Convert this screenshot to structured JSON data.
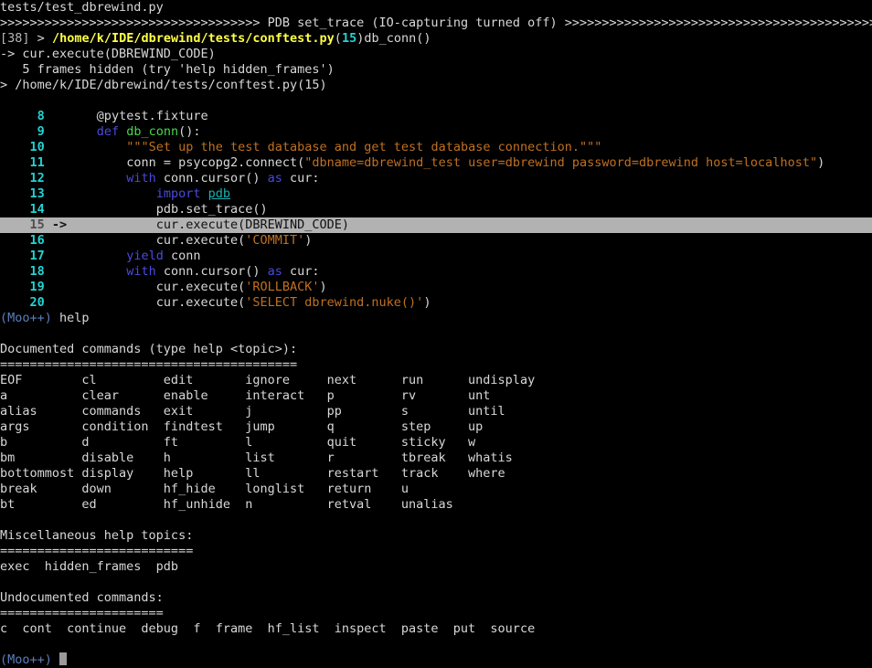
{
  "terminal": {
    "title": "tests/test_dbrewind.py",
    "background": "#000000",
    "foreground": "#d8d8d8",
    "highlight_color": "#b2b2b2",
    "prompt": "(Moo++)"
  },
  "header": {
    "file_line": "tests/test_dbrewind.py",
    "separator_left": ">>>>>>>>>>>>>>>>>>>>>>>>>>>>>>>>>>>",
    "separator_label": "PDB set_trace (IO-capturing turned off)",
    "separator_right": ">>>>>>>>>>>>>>>>>>>>>>>>>>>>>>>>>>>>>>>>>>>>>>>>>>>>>",
    "frame_index": "[38]",
    "frame_gt": ">",
    "frame_path": "/home/k/IDE/dbrewind/tests/conftest.py",
    "frame_open_paren": "(",
    "frame_lineno": "15",
    "frame_close_paren": ")",
    "frame_func": "db_conn()",
    "current_stmt": "-> cur.execute(DBREWIND_CODE)",
    "frames_hidden": "   5 frames hidden (try 'help hidden_frames')",
    "location_line": "> /home/k/IDE/dbrewind/tests/conftest.py(15)"
  },
  "source": {
    "lines": [
      {
        "number": "8",
        "arrow": "",
        "current": false,
        "tokens": [
          {
            "text": "    @pytest.fixture",
            "cls": "c-white"
          }
        ]
      },
      {
        "number": "9",
        "arrow": "",
        "current": false,
        "tokens": [
          {
            "text": "    ",
            "cls": "c-white"
          },
          {
            "text": "def",
            "cls": "c-blue"
          },
          {
            "text": " ",
            "cls": "c-white"
          },
          {
            "text": "db_conn",
            "cls": "c-green"
          },
          {
            "text": "():",
            "cls": "c-white"
          }
        ]
      },
      {
        "number": "10",
        "arrow": "",
        "current": false,
        "tokens": [
          {
            "text": "        ",
            "cls": "c-white"
          },
          {
            "text": "\"\"\"Set up the test database and get test database connection.\"\"\"",
            "cls": "c-orange"
          }
        ]
      },
      {
        "number": "11",
        "arrow": "",
        "current": false,
        "tokens": [
          {
            "text": "        conn = psycopg2.connect(",
            "cls": "c-white"
          },
          {
            "text": "\"dbname=dbrewind_test user=dbrewind password=dbrewind host=localhost\"",
            "cls": "c-orange"
          },
          {
            "text": ")",
            "cls": "c-white"
          }
        ]
      },
      {
        "number": "12",
        "arrow": "",
        "current": false,
        "tokens": [
          {
            "text": "        ",
            "cls": "c-white"
          },
          {
            "text": "with",
            "cls": "c-blue"
          },
          {
            "text": " conn.cursor() ",
            "cls": "c-white"
          },
          {
            "text": "as",
            "cls": "c-blue"
          },
          {
            "text": " cur:",
            "cls": "c-white"
          }
        ]
      },
      {
        "number": "13",
        "arrow": "",
        "current": false,
        "tokens": [
          {
            "text": "            ",
            "cls": "c-white"
          },
          {
            "text": "import",
            "cls": "c-blue"
          },
          {
            "text": " ",
            "cls": "c-white"
          },
          {
            "text": "pdb",
            "cls": "c-cyan underline"
          }
        ]
      },
      {
        "number": "14",
        "arrow": "",
        "current": false,
        "tokens": [
          {
            "text": "            pdb.set_trace()",
            "cls": "c-white"
          }
        ]
      },
      {
        "number": "15",
        "arrow": "->",
        "current": true,
        "tokens": [
          {
            "text": "            cur.execute(DBREWIND_CODE)",
            "cls": "code"
          }
        ]
      },
      {
        "number": "16",
        "arrow": "",
        "current": false,
        "tokens": [
          {
            "text": "            cur.execute(",
            "cls": "c-white"
          },
          {
            "text": "'COMMIT'",
            "cls": "c-orange"
          },
          {
            "text": ")",
            "cls": "c-white"
          }
        ]
      },
      {
        "number": "17",
        "arrow": "",
        "current": false,
        "tokens": [
          {
            "text": "        ",
            "cls": "c-white"
          },
          {
            "text": "yield",
            "cls": "c-blue"
          },
          {
            "text": " conn",
            "cls": "c-white"
          }
        ]
      },
      {
        "number": "18",
        "arrow": "",
        "current": false,
        "tokens": [
          {
            "text": "        ",
            "cls": "c-white"
          },
          {
            "text": "with",
            "cls": "c-blue"
          },
          {
            "text": " conn.cursor() ",
            "cls": "c-white"
          },
          {
            "text": "as",
            "cls": "c-blue"
          },
          {
            "text": " cur:",
            "cls": "c-white"
          }
        ]
      },
      {
        "number": "19",
        "arrow": "",
        "current": false,
        "tokens": [
          {
            "text": "            cur.execute(",
            "cls": "c-white"
          },
          {
            "text": "'ROLLBACK'",
            "cls": "c-orange"
          },
          {
            "text": ")",
            "cls": "c-white"
          }
        ]
      },
      {
        "number": "20",
        "arrow": "",
        "current": false,
        "tokens": [
          {
            "text": "            cur.execute(",
            "cls": "c-white"
          },
          {
            "text": "'SELECT dbrewind.nuke()'",
            "cls": "c-orange"
          },
          {
            "text": ")",
            "cls": "c-white"
          }
        ]
      }
    ]
  },
  "session": {
    "help_command_echo": "help",
    "documented_header": "Documented commands (type help <topic>):",
    "documented_rule": "========================================",
    "documented_columns": [
      [
        "EOF",
        "cl",
        "edit",
        "ignore",
        "next",
        "run",
        "undisplay"
      ],
      [
        "a",
        "clear",
        "enable",
        "interact",
        "p",
        "rv",
        "unt"
      ],
      [
        "alias",
        "commands",
        "exit",
        "j",
        "pp",
        "s",
        "until"
      ],
      [
        "args",
        "condition",
        "findtest",
        "jump",
        "q",
        "step",
        "up"
      ],
      [
        "b",
        "d",
        "ft",
        "l",
        "quit",
        "sticky",
        "w"
      ],
      [
        "bm",
        "disable",
        "h",
        "list",
        "r",
        "tbreak",
        "whatis"
      ],
      [
        "bottommost",
        "display",
        "help",
        "ll",
        "restart",
        "track",
        "where"
      ],
      [
        "break",
        "down",
        "hf_hide",
        "longlist",
        "return",
        "u",
        ""
      ],
      [
        "bt",
        "ed",
        "hf_unhide",
        "n",
        "retval",
        "unalias",
        ""
      ]
    ],
    "misc_header": "Miscellaneous help topics:",
    "misc_rule": "==========================",
    "misc_items": "exec  hidden_frames  pdb",
    "undocumented_header": "Undocumented commands:",
    "undocumented_rule": "======================",
    "undocumented_items": "c  cont  continue  debug  f  frame  hf_list  inspect  paste  put  source",
    "final_prompt": "(Moo++)"
  }
}
